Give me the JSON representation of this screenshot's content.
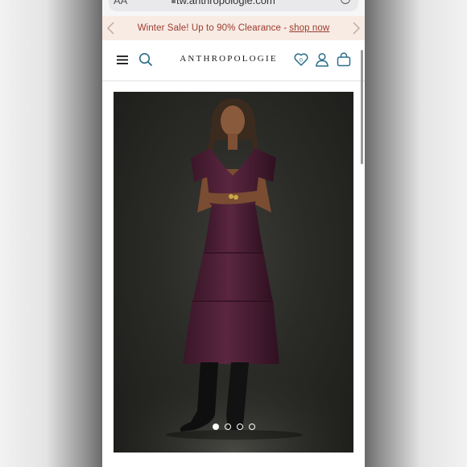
{
  "browser": {
    "text_size_label": "AA",
    "url": "tw.anthropologie.com"
  },
  "promo": {
    "text": "Winter Sale! Up to 90% Clearance -",
    "link_label": "shop now"
  },
  "header": {
    "logo": "ANTHROPOLOGIE",
    "icons": [
      "menu-icon",
      "search-icon",
      "wishlist-heart-icon",
      "account-icon",
      "shopping-bag-icon"
    ]
  },
  "colors": {
    "promo_background": "#f7ebe4",
    "promo_text": "#9c3b2c",
    "icon_teal": "#2a6f8a",
    "dress_plum": "#4a1f33",
    "photo_background": "#2a2a27"
  },
  "product_gallery": {
    "image": "model-in-plum-tiered-midi-dress-with-black-boots",
    "slide_count": 4,
    "active_slide": 1
  }
}
